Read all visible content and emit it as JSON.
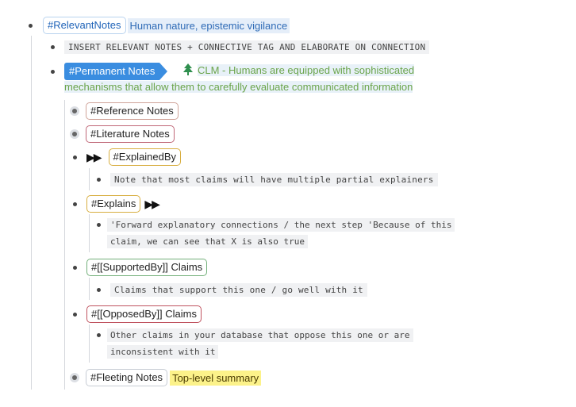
{
  "root": {
    "tag": "#RelevantNotes",
    "text": "Human nature, epistemic vigilance"
  },
  "instruction": "INSERT RELEVANT NOTES + CONNECTIVE TAG AND ELABORATE ON CONNECTION",
  "permanent": {
    "tag": "#Permanent Notes",
    "icon": "tree-icon",
    "line1": "CLM - Humans are equipped with sophisticated",
    "line2": "mechanisms that allow them to carefully evaluate communicated information"
  },
  "children": {
    "reference": "#Reference Notes",
    "literature": "#Literature Notes",
    "explained_by": {
      "arrows": "▶▶",
      "tag": "#ExplainedBy",
      "note": "Note that most claims will have multiple partial explainers"
    },
    "explains": {
      "tag": "#Explains",
      "arrows": "▶▶",
      "note_line1": "'Forward explanatory connections / the next step 'Because of this",
      "note_line2": "claim, we can see that X is also true"
    },
    "supported_by": {
      "tag": "#[[SupportedBy]] Claims",
      "note": "Claims that support this one / go well with it"
    },
    "opposed_by": {
      "tag": "#[[OpposedBy]] Claims",
      "note_line1": "Other claims in your database that oppose this one or are",
      "note_line2": "inconsistent with it"
    },
    "fleeting": {
      "tag": "#Fleeting Notes",
      "summary": "Top-level summary"
    }
  }
}
